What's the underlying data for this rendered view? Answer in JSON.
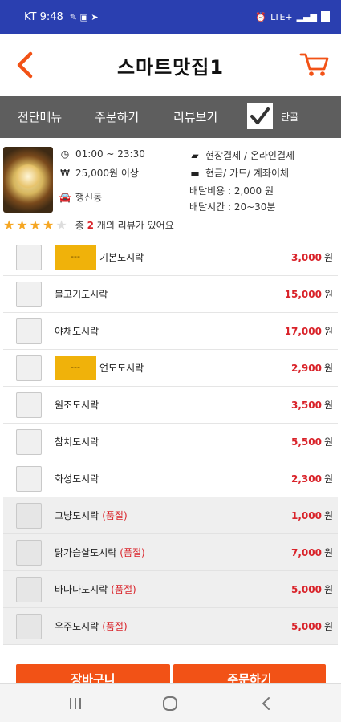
{
  "status": {
    "carrier_time": "KT 9:48",
    "right_text": "LTE+"
  },
  "header": {
    "title": "스마트맛집1"
  },
  "tabs": [
    {
      "label": "전단메뉴"
    },
    {
      "label": "주문하기"
    },
    {
      "label": "리뷰보기"
    }
  ],
  "group_toggle": {
    "label": "단골",
    "checked": true
  },
  "store": {
    "hours": "01:00 ~ 23:30",
    "min_order": "25,000원 이상",
    "area": "행신동",
    "payment_place": "현장결제 / 온라인결제",
    "payment_method": "현금/ 카드/ 계좌이체",
    "delivery_fee": "배달비용 : 2,000 원",
    "delivery_time": "배달시간 : 20~30분"
  },
  "rating": {
    "stars": 4,
    "max": 5,
    "prefix": "총",
    "count": "2",
    "suffix": "개의 리뷰가 있어요"
  },
  "menu": {
    "price_unit": "원",
    "soldout_tag": "(품절)",
    "items": [
      {
        "name": "기본도시락",
        "price": "3,000",
        "badge": "---",
        "soldout": false
      },
      {
        "name": "불고기도시락",
        "price": "15,000",
        "badge": "",
        "soldout": false
      },
      {
        "name": "야채도시락",
        "price": "17,000",
        "badge": "",
        "soldout": false
      },
      {
        "name": "연도도시락",
        "price": "2,900",
        "badge": "---",
        "soldout": false
      },
      {
        "name": "원조도시락",
        "price": "3,500",
        "badge": "",
        "soldout": false
      },
      {
        "name": "참치도시락",
        "price": "5,500",
        "badge": "",
        "soldout": false
      },
      {
        "name": "화성도시락",
        "price": "2,300",
        "badge": "",
        "soldout": false
      },
      {
        "name": "그냥도시락",
        "price": "1,000",
        "badge": "",
        "soldout": true
      },
      {
        "name": "닭가슴살도시락",
        "price": "7,000",
        "badge": "",
        "soldout": true
      },
      {
        "name": "바나나도시락",
        "price": "5,000",
        "badge": "",
        "soldout": true
      },
      {
        "name": "우주도시락",
        "price": "5,000",
        "badge": "",
        "soldout": true
      }
    ]
  },
  "actions": {
    "left_label": "장바구니",
    "right_label": "주문하기"
  },
  "colors": {
    "status_bar": "#2a3fb0",
    "accent_orange": "#f25216",
    "price_red": "#d9232a",
    "tab_bg": "#5e5e5e",
    "badge_yellow": "#f0b20a"
  }
}
